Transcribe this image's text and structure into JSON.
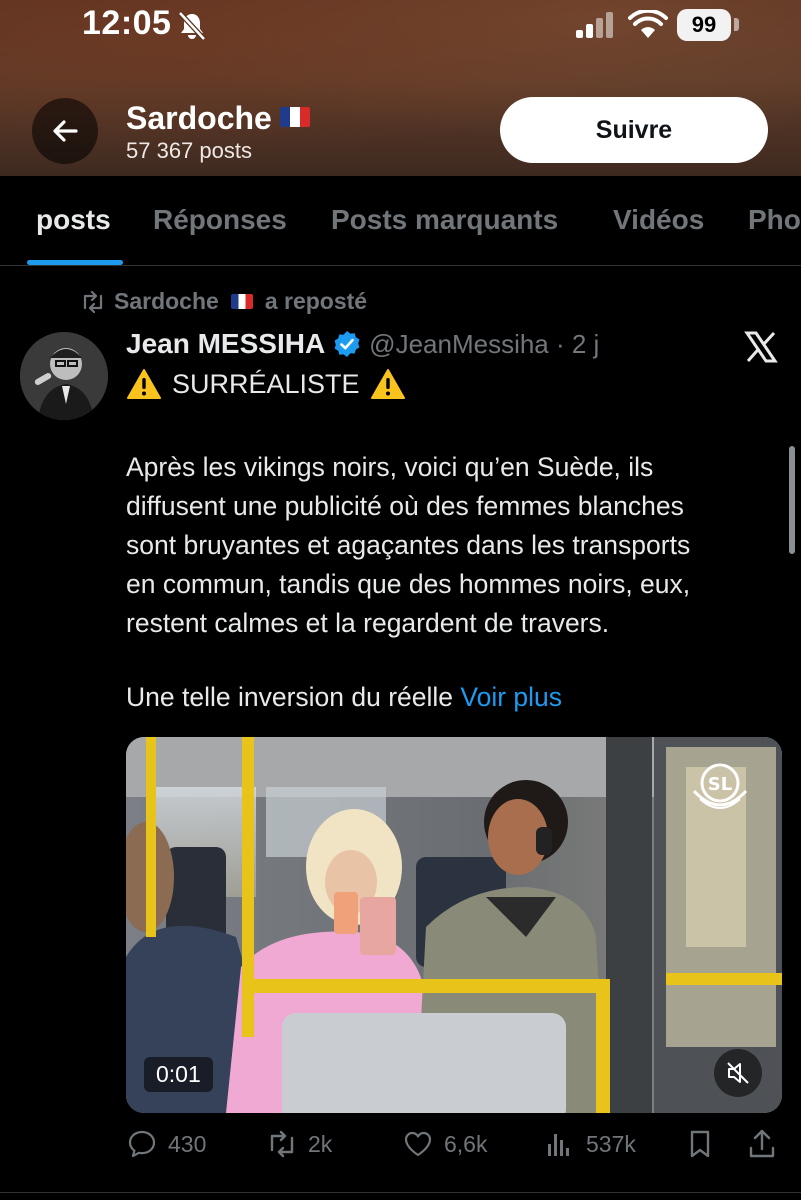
{
  "status_bar": {
    "time": "12:05",
    "battery": "99",
    "icons": [
      "bell-off-icon",
      "signal-icon",
      "wifi-icon",
      "battery-icon"
    ]
  },
  "profile": {
    "name": "Sardoche",
    "posts_count": "57 367 posts",
    "follow_label": "Suivre"
  },
  "tabs": [
    {
      "label": "posts",
      "active": true
    },
    {
      "label": "Réponses"
    },
    {
      "label": "Posts marquants"
    },
    {
      "label": "Vidéos"
    },
    {
      "label": "Pho"
    }
  ],
  "post": {
    "repost_by": "Sardoche",
    "repost_suffix": "a reposté",
    "author_name": "Jean MESSIHA",
    "author_handle": "@JeanMessiha · 2 j",
    "headline": "SURRÉALISTE",
    "body": [
      "Après les vikings noirs, voici qu’en Suède, ils",
      "diffusent une publicité où des femmes blanches",
      "sont bruyantes et agaçantes dans les transports",
      "en commun, tandis que des hommes noirs, eux,",
      "restent calmes et la regardent de travers."
    ],
    "more_text": "Une telle inversion du réelle",
    "see_more": "Voir plus",
    "video": {
      "timestamp": "0:01",
      "logo_text": "SL"
    }
  },
  "actions": {
    "replies": "430",
    "reposts": "2k",
    "likes": "6,6k",
    "views": "537k"
  },
  "colors": {
    "accent": "#1d9bf0",
    "muted": "#71767b",
    "background": "#000000",
    "text": "#e7e9ea"
  }
}
